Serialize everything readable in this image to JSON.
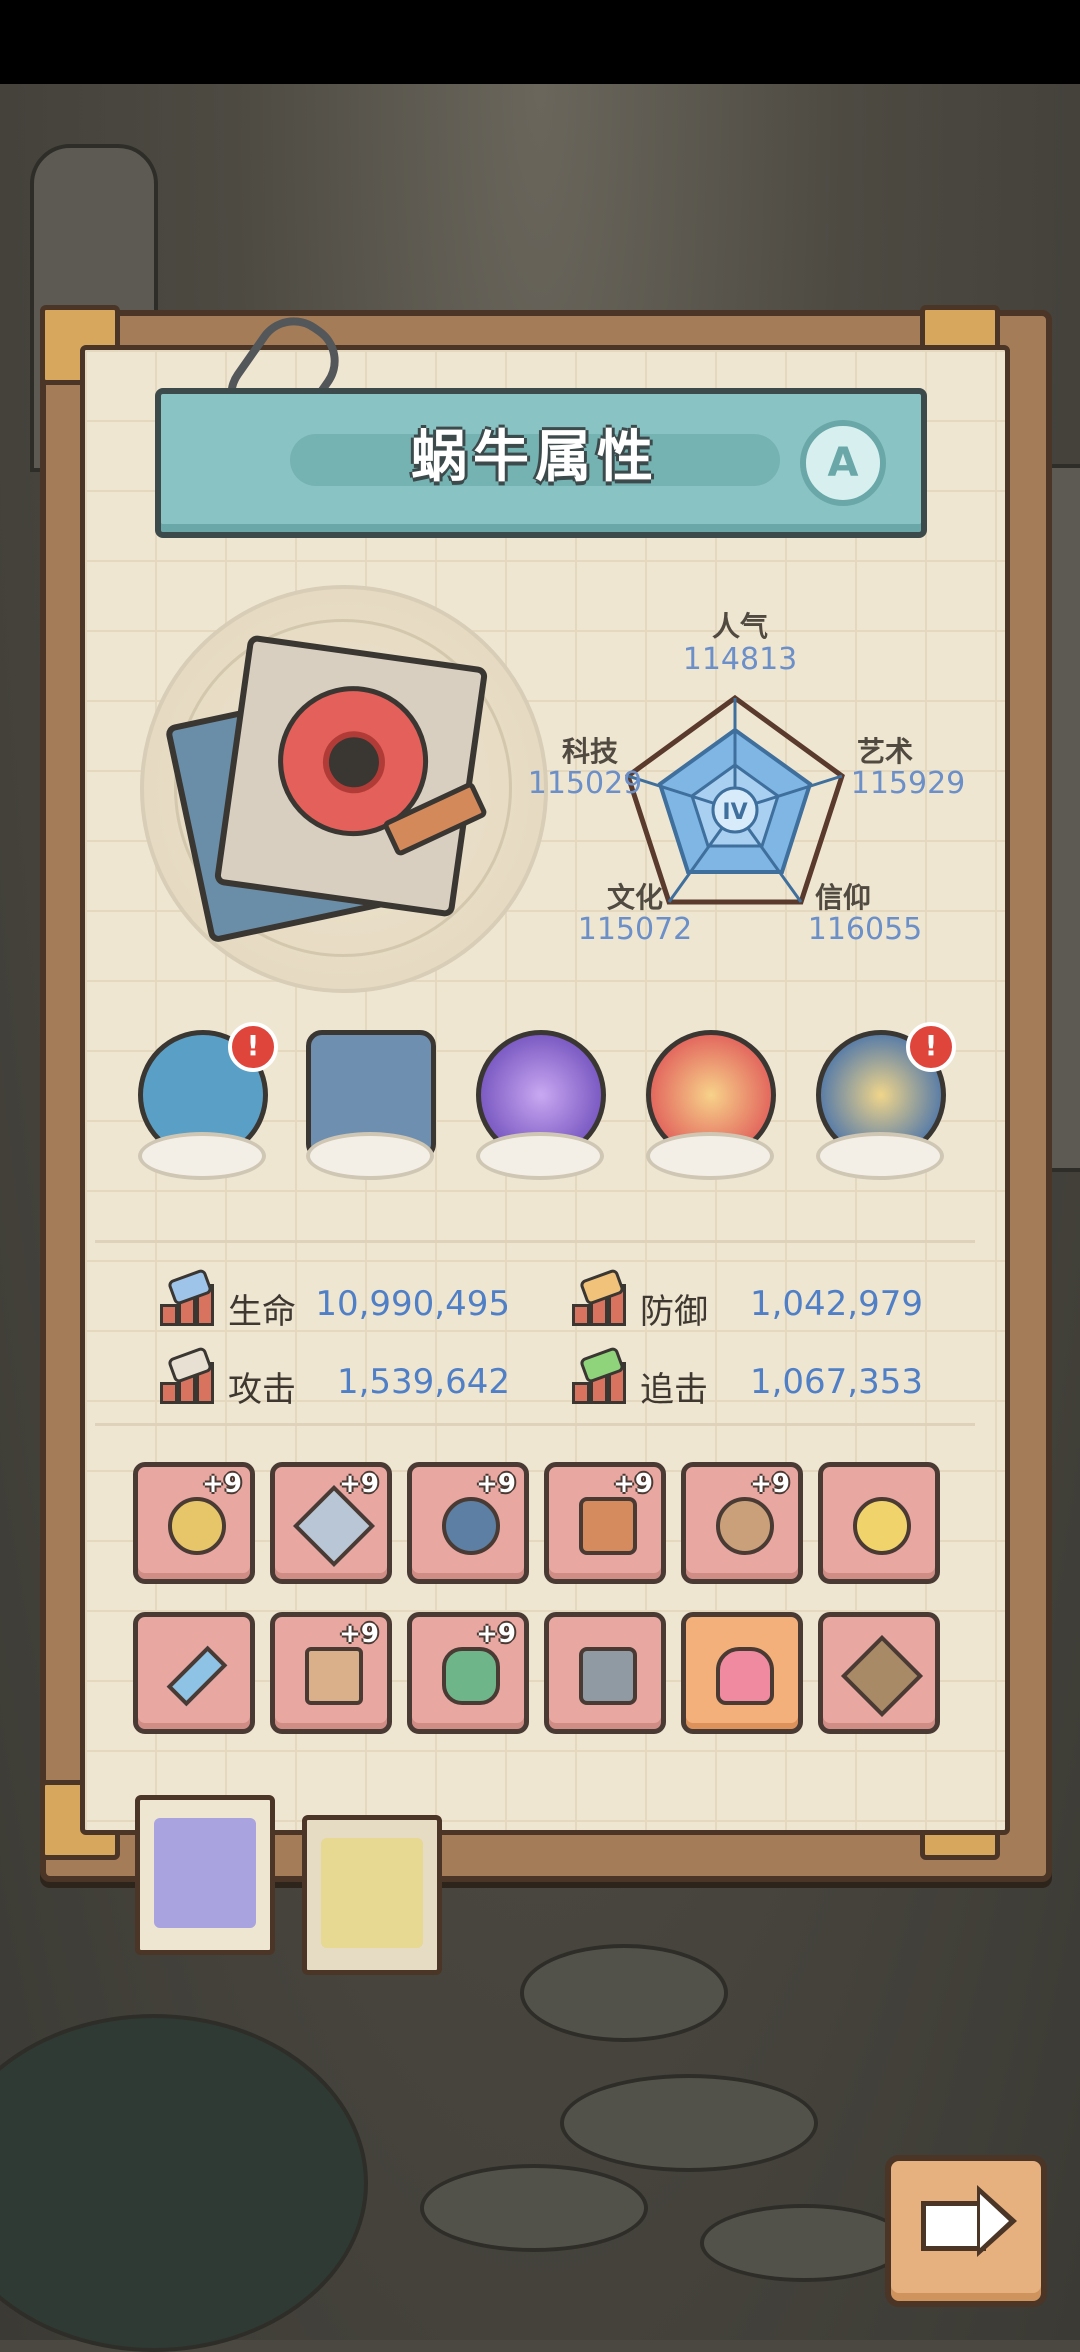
{
  "panel": {
    "title": "蜗牛属性",
    "grade": "A",
    "radar_level": "IV"
  },
  "radar": {
    "popularity": {
      "label": "人气",
      "value": "114813"
    },
    "tech": {
      "label": "科技",
      "value": "115029"
    },
    "art": {
      "label": "艺术",
      "value": "115929"
    },
    "culture": {
      "label": "文化",
      "value": "115072"
    },
    "faith": {
      "label": "信仰",
      "value": "116055"
    }
  },
  "relics": [
    {
      "icon": "monster-relic-icon",
      "color": "#5a9fc6",
      "alert": "!"
    },
    {
      "icon": "skull-box-relic-icon",
      "color": "#6f8fb0",
      "alert": ""
    },
    {
      "icon": "planet-orb-relic-icon",
      "color": "#7d5cc4",
      "alert": ""
    },
    {
      "icon": "flame-orb-relic-icon",
      "color": "#e36a5f",
      "alert": ""
    },
    {
      "icon": "gem-ring-relic-icon",
      "color": "#5d7fa6",
      "alert": "!"
    }
  ],
  "attributes": {
    "hp": {
      "label": "生命",
      "value": "10,990,495"
    },
    "defense": {
      "label": "防御",
      "value": "1,042,979"
    },
    "attack": {
      "label": "攻击",
      "value": "1,539,642"
    },
    "pursuit": {
      "label": "追击",
      "value": "1,067,353"
    }
  },
  "equipment": [
    {
      "icon": "hammer-weapon-icon",
      "plus": "+9",
      "style": "pink"
    },
    {
      "icon": "dagger-weapon-icon",
      "plus": "+9",
      "style": "pink"
    },
    {
      "icon": "ring-armor-icon",
      "plus": "+9",
      "style": "pink"
    },
    {
      "icon": "dna-staff-icon",
      "plus": "+9",
      "style": "pink"
    },
    {
      "icon": "orb-gadget-icon",
      "plus": "+9",
      "style": "pink"
    },
    {
      "icon": "golden-ring-icon",
      "plus": "",
      "style": "pink"
    },
    {
      "icon": "sword-icon",
      "plus": "",
      "style": "pink"
    },
    {
      "icon": "pants-armor-icon",
      "plus": "+9",
      "style": "pink"
    },
    {
      "icon": "trident-icon",
      "plus": "+9",
      "style": "pink"
    },
    {
      "icon": "robot-chip-icon",
      "plus": "",
      "style": "pink"
    },
    {
      "icon": "claw-glove-icon",
      "plus": "",
      "style": "orange"
    },
    {
      "icon": "crossbow-icon",
      "plus": "",
      "style": "pink"
    }
  ],
  "tabs": [
    {
      "icon": "snail-face-icon",
      "active": true
    },
    {
      "icon": "shell-icon",
      "active": false
    }
  ],
  "next_button": {
    "icon": "arrow-right-icon"
  }
}
